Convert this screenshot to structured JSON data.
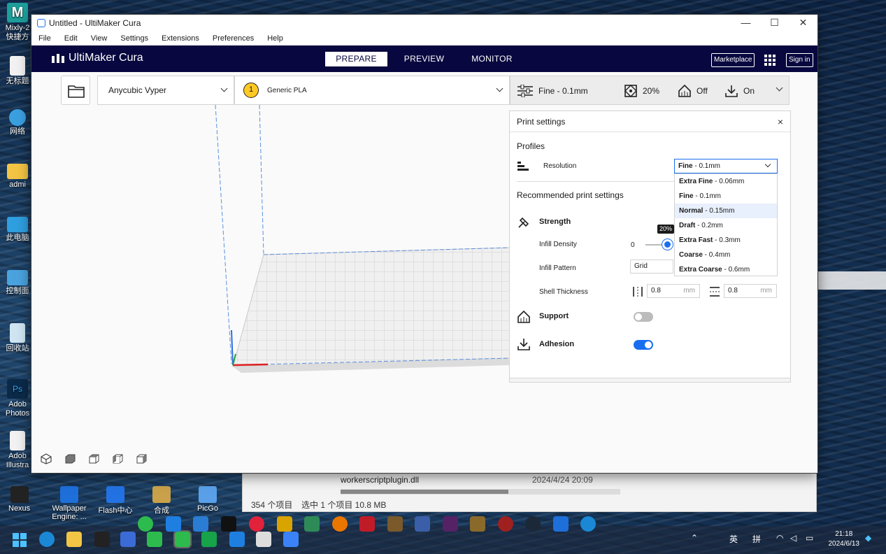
{
  "desktop": {
    "icons": [
      {
        "label": "Mixly-2",
        "sub": "快捷方"
      },
      {
        "label": "无标题"
      },
      {
        "label": "网络"
      },
      {
        "label": "admi"
      },
      {
        "label": "此电脑"
      },
      {
        "label": "控制面"
      },
      {
        "label": "回收站"
      },
      {
        "label": "Adob",
        "sub": "Photos"
      },
      {
        "label": "Adob",
        "sub": "Illustra"
      }
    ],
    "pinned": [
      "Nexus",
      "Wallpaper",
      "Engine: ...",
      "Flash中心",
      "合成",
      "PicGo"
    ]
  },
  "explorer": {
    "file_name": "workerscriptplugin.dll",
    "file_date": "2024/4/24 20:09",
    "item_count": "354 个项目",
    "selection": "选中 1 个项目  10.8 MB"
  },
  "window": {
    "title": "Untitled - UltiMaker Cura",
    "controls": {
      "minimize": "—",
      "maximize": "☐",
      "close": "✕"
    }
  },
  "menu": [
    "File",
    "Edit",
    "View",
    "Settings",
    "Extensions",
    "Preferences",
    "Help"
  ],
  "header": {
    "logo": "UltiMaker Cura",
    "stages": [
      "PREPARE",
      "PREVIEW",
      "MONITOR"
    ],
    "active_stage": "PREPARE",
    "marketplace": "Marketplace",
    "signin": "Sign in"
  },
  "toolbar": {
    "machine": "Anycubic Vyper",
    "extruder_number": "1",
    "material": "Generic PLA",
    "profile": "Fine - 0.1mm",
    "infill": "20%",
    "support": "Off",
    "adhesion": "On"
  },
  "print_settings": {
    "title": "Print settings",
    "close": "×",
    "profiles_heading": "Profiles",
    "resolution_label": "Resolution",
    "resolution_selected_bold": "Fine",
    "resolution_selected_rest": " - 0.1mm",
    "resolution_options": [
      {
        "name": "Extra Fine",
        "rest": " - 0.06mm"
      },
      {
        "name": "Fine",
        "rest": " - 0.1mm"
      },
      {
        "name": "Normal",
        "rest": " - 0.15mm"
      },
      {
        "name": "Draft",
        "rest": " - 0.2mm"
      },
      {
        "name": "Extra Fast",
        "rest": " - 0.3mm"
      },
      {
        "name": "Coarse",
        "rest": " - 0.4mm"
      },
      {
        "name": "Extra Coarse",
        "rest": " - 0.6mm"
      }
    ],
    "hovered_option": "Normal",
    "recommended_heading": "Recommended print settings",
    "strength": "Strength",
    "infill_density_label": "Infill Density",
    "infill_min": "0",
    "infill_tooltip": "20%",
    "infill_density": 0.2,
    "infill_pattern_label": "Infill Pattern",
    "infill_pattern": "Grid",
    "shell_thickness_label": "Shell Thickness",
    "wall_thickness": "0.8",
    "top_bottom_thickness": "0.8",
    "unit": "mm",
    "support": "Support",
    "support_enabled": false,
    "adhesion": "Adhesion",
    "adhesion_enabled": true
  },
  "taskbar": {
    "lang1": "英",
    "lang2": "拼",
    "time": "21:18",
    "date": "2024/6/13"
  }
}
